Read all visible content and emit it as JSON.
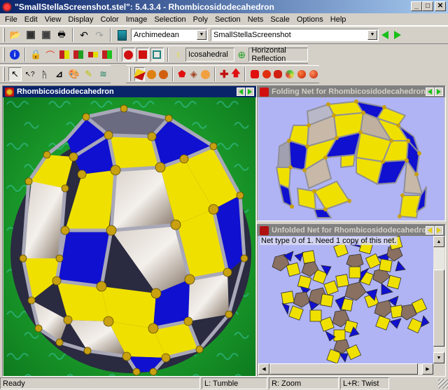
{
  "window": {
    "title": "\"SmallStellaScreenshot.stel\": 5.4.3.4 - Rhombicosidodecahedron",
    "buttons": {
      "minimize": "_",
      "maximize": "□",
      "close": "✕"
    }
  },
  "menubar": {
    "items": [
      "File",
      "Edit",
      "View",
      "Display",
      "Color",
      "Image",
      "Selection",
      "Poly",
      "Section",
      "Nets",
      "Scale",
      "Options",
      "Help"
    ]
  },
  "toolbar1": {
    "icons": [
      "open-icon",
      "save-icon",
      "save-as-icon",
      "print-icon",
      "undo-icon",
      "redo-icon",
      "library-icon"
    ],
    "category_combo": "Archimedean",
    "model_combo": "SmallStellaScreenshot",
    "prev": "previous-model",
    "next": "next-model"
  },
  "toolbar2": {
    "symmetry_field": "Icosahedral",
    "reflection_field": "Horizontal Reflection"
  },
  "panels": {
    "main": {
      "title": "Rhombicosidodecahedron"
    },
    "folding": {
      "title": "Folding Net for Rhombicosidodecahedron"
    },
    "unfolded": {
      "title": "Unfolded Net for Rhombicosidodecahedron",
      "info": "Net type 0 of 1.  Need 1 copy of this net."
    }
  },
  "statusbar": {
    "status": "Ready",
    "left": "L: Tumble",
    "right": "R: Zoom",
    "both": "L+R: Twist"
  },
  "colors": {
    "active_title": "#0a246a",
    "inactive_title": "#808080",
    "face_yellow": "#f0e000",
    "face_blue": "#1010d0",
    "bg_green": "#1a9a2a",
    "net_bg": "#b0b4f4"
  }
}
